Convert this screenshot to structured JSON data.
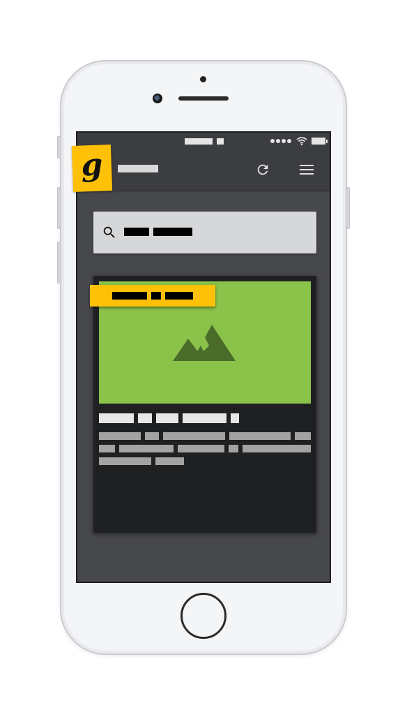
{
  "phone": {
    "model_icons": [
      "camera-icon",
      "speaker-grille",
      "home-button"
    ]
  },
  "status_bar": {
    "time": "",
    "icons": [
      "signal-icon",
      "wifi-icon",
      "battery-icon"
    ]
  },
  "app_bar": {
    "logo_letter": "g",
    "title": "",
    "actions": [
      {
        "name": "refresh",
        "icon": "refresh-icon"
      },
      {
        "name": "menu",
        "icon": "menu-icon"
      }
    ]
  },
  "search": {
    "icon": "search-icon",
    "value": ""
  },
  "card": {
    "badge_label": "",
    "image_icon": "image-placeholder-icon",
    "title": "",
    "body": ""
  },
  "colors": {
    "accent": "#ffc107",
    "screen_bg": "#47484c",
    "appbar_bg": "#3b3d40",
    "card_bg": "#1f2022",
    "image_bg": "#8bc34a",
    "image_icon": "#4a6b2a",
    "search_bg": "#d6d7d9"
  }
}
